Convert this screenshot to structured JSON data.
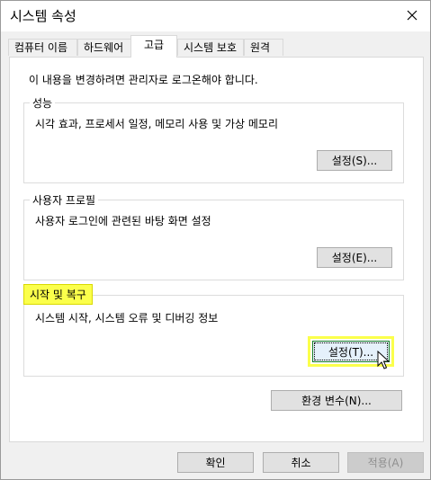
{
  "window": {
    "title": "시스템 속성"
  },
  "tabs": [
    {
      "label": "컴퓨터 이름"
    },
    {
      "label": "하드웨어"
    },
    {
      "label": "고급"
    },
    {
      "label": "시스템 보호"
    },
    {
      "label": "원격"
    }
  ],
  "notice": "이 내용을 변경하려면 관리자로 로그온해야 합니다.",
  "performance": {
    "legend": "성능",
    "description": "시각 효과, 프로세서 일정, 메모리 사용 및 가상 메모리",
    "button": "설정(S)..."
  },
  "user_profiles": {
    "legend": "사용자 프로필",
    "description": "사용자 로그인에 관련된 바탕 화면 설정",
    "button": "설정(E)..."
  },
  "startup_recovery": {
    "legend": "시작 및 복구",
    "description": "시스템 시작, 시스템 오류 및 디버깅 정보",
    "button": "설정(T)..."
  },
  "env_button": "환경 변수(N)...",
  "footer": {
    "ok": "확인",
    "cancel": "취소",
    "apply": "적용(A)"
  }
}
